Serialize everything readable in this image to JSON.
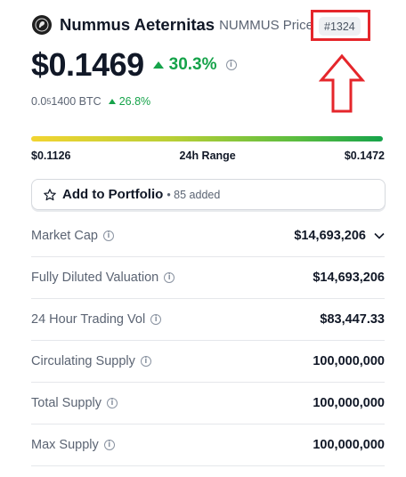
{
  "coin": {
    "name": "Nummus Aeternitas",
    "symbol_text": "NUMMUS Price",
    "rank": "#1324"
  },
  "price": {
    "usd": "$0.1469",
    "change_24h": "30.3%",
    "btc_prefix": "0.0",
    "btc_sub": "5",
    "btc_rest": "1400 BTC",
    "btc_change": "26.8%"
  },
  "range": {
    "low": "$0.1126",
    "label": "24h Range",
    "high": "$0.1472"
  },
  "portfolio": {
    "label": "Add to Portfolio",
    "count": "• 85 added"
  },
  "stats": [
    {
      "label": "Market Cap",
      "value": "$14,693,206"
    },
    {
      "label": "Fully Diluted Valuation",
      "value": "$14,693,206"
    },
    {
      "label": "24 Hour Trading Vol",
      "value": "$83,447.33"
    },
    {
      "label": "Circulating Supply",
      "value": "100,000,000"
    },
    {
      "label": "Total Supply",
      "value": "100,000,000"
    },
    {
      "label": "Max Supply",
      "value": "100,000,000"
    }
  ],
  "colors": {
    "positive": "#16a34a",
    "annotation": "#e5262b",
    "range_start": "#f2d431",
    "range_end": "#16a34a"
  },
  "icons": [
    "coin-logo-icon",
    "info-icon",
    "star-icon",
    "chevron-down-icon",
    "up-arrow-annotation-icon",
    "caret-up-icon"
  ]
}
